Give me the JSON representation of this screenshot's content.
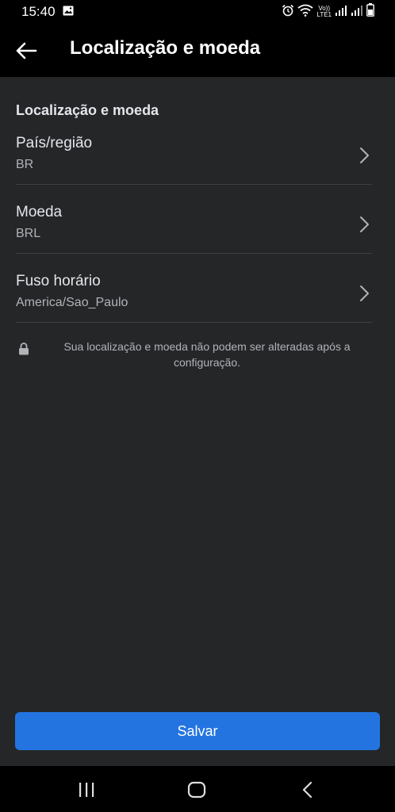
{
  "status_bar": {
    "time": "15:40",
    "volte_top": "Vo))",
    "volte_bottom": "LTE1"
  },
  "header": {
    "title": "Localização e moeda",
    "back_icon": "arrow-left-icon"
  },
  "section": {
    "title": "Localização e moeda"
  },
  "rows": [
    {
      "label": "País/região",
      "value": "BR"
    },
    {
      "label": "Moeda",
      "value": "BRL"
    },
    {
      "label": "Fuso horário",
      "value": "America/Sao_Paulo"
    }
  ],
  "notice": {
    "text": "Sua localização e moeda não podem ser alteradas após a configuração.",
    "icon": "lock-icon"
  },
  "save_button": {
    "label": "Salvar"
  },
  "colors": {
    "accent": "#2374e1",
    "background": "#252628",
    "header": "#000000",
    "divider": "#3e4042",
    "secondary_text": "#b0b3b8"
  },
  "nav_bar": {
    "icons": [
      "recent-apps-icon",
      "home-icon",
      "back-icon"
    ]
  }
}
